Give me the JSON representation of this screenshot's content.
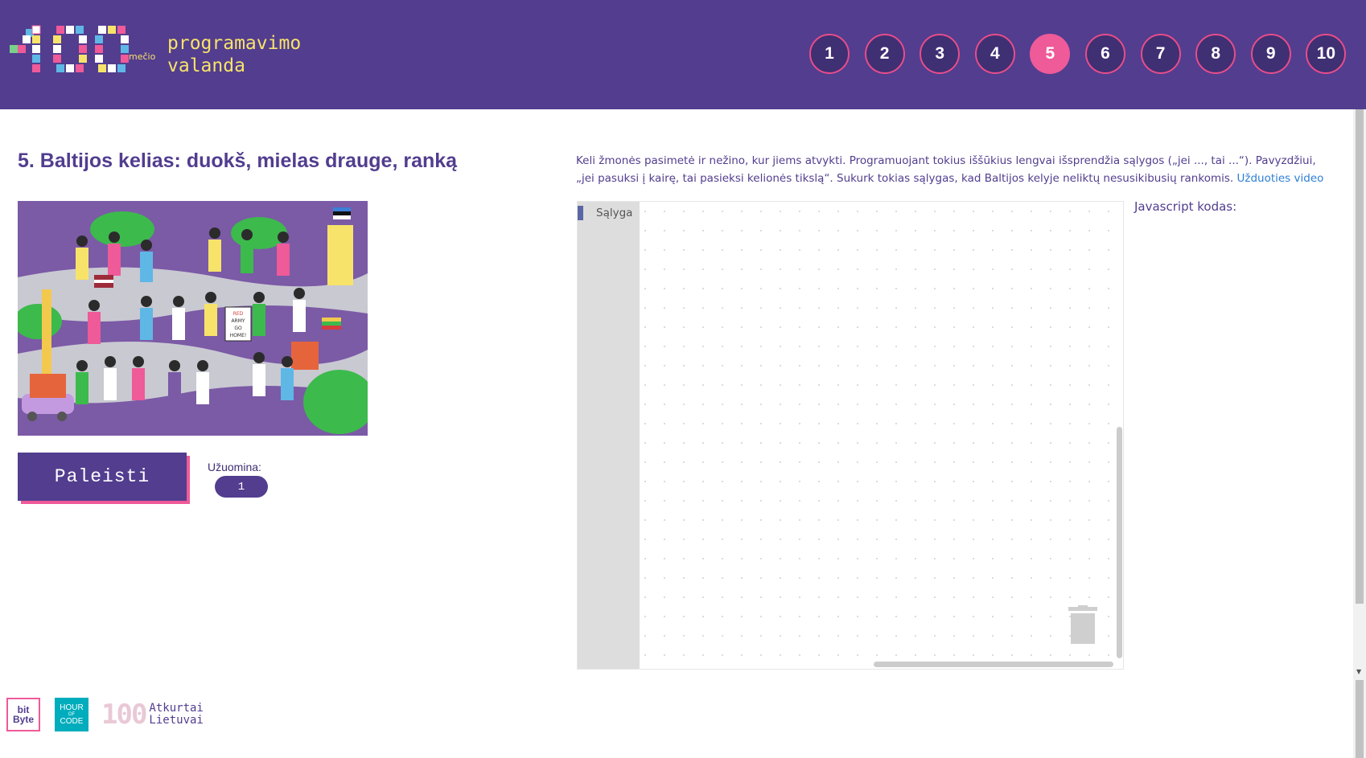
{
  "header": {
    "logo_number": "100",
    "logo_suffix": "mečio",
    "logo_line1": "programavimo",
    "logo_line2": "valanda",
    "levels": [
      "1",
      "2",
      "3",
      "4",
      "5",
      "6",
      "7",
      "8",
      "9",
      "10"
    ],
    "active_level": "5"
  },
  "task": {
    "title": "5. Baltijos kelias: duokš, mielas drauge, ranką",
    "description": "Keli žmonės pasimetė ir nežino, kur jiems atvykti. Programuojant tokius iššūkius lengvai išsprendžia sąlygos („jei ..., tai ...“). Pavyzdžiui, „jei pasuksi į kairę, tai pasieksi kelionės tikslą“. Sukurk tokias sąlygas, kad Baltijos kelyje neliktų nesusikibusių rankomis.",
    "video_link": "Užduoties video",
    "illustration_sign": [
      "RED",
      "ARMY",
      "GO",
      "HOME!"
    ]
  },
  "controls": {
    "run_label": "Paleisti",
    "hint_label": "Užuomina:",
    "hint_value": "1"
  },
  "workspace": {
    "toolbox_category": "Sąlyga",
    "category_color": "#5b67a5",
    "js_label": "Javascript kodas:"
  },
  "footer": {
    "bitbyte_top": "bit",
    "bitbyte_bottom": "Byte",
    "hoc_top": "HOUR",
    "hoc_mid": "OF",
    "hoc_bottom": "CODE",
    "atkurtai_num": "100",
    "atkurtai_line1": "Atkurtai",
    "atkurtai_line2": "Lietuvai"
  },
  "colors": {
    "header_bg": "#523d8f",
    "accent_pink": "#ef5a99",
    "logo_yellow": "#f7e36a",
    "link_blue": "#2d7fd6"
  }
}
